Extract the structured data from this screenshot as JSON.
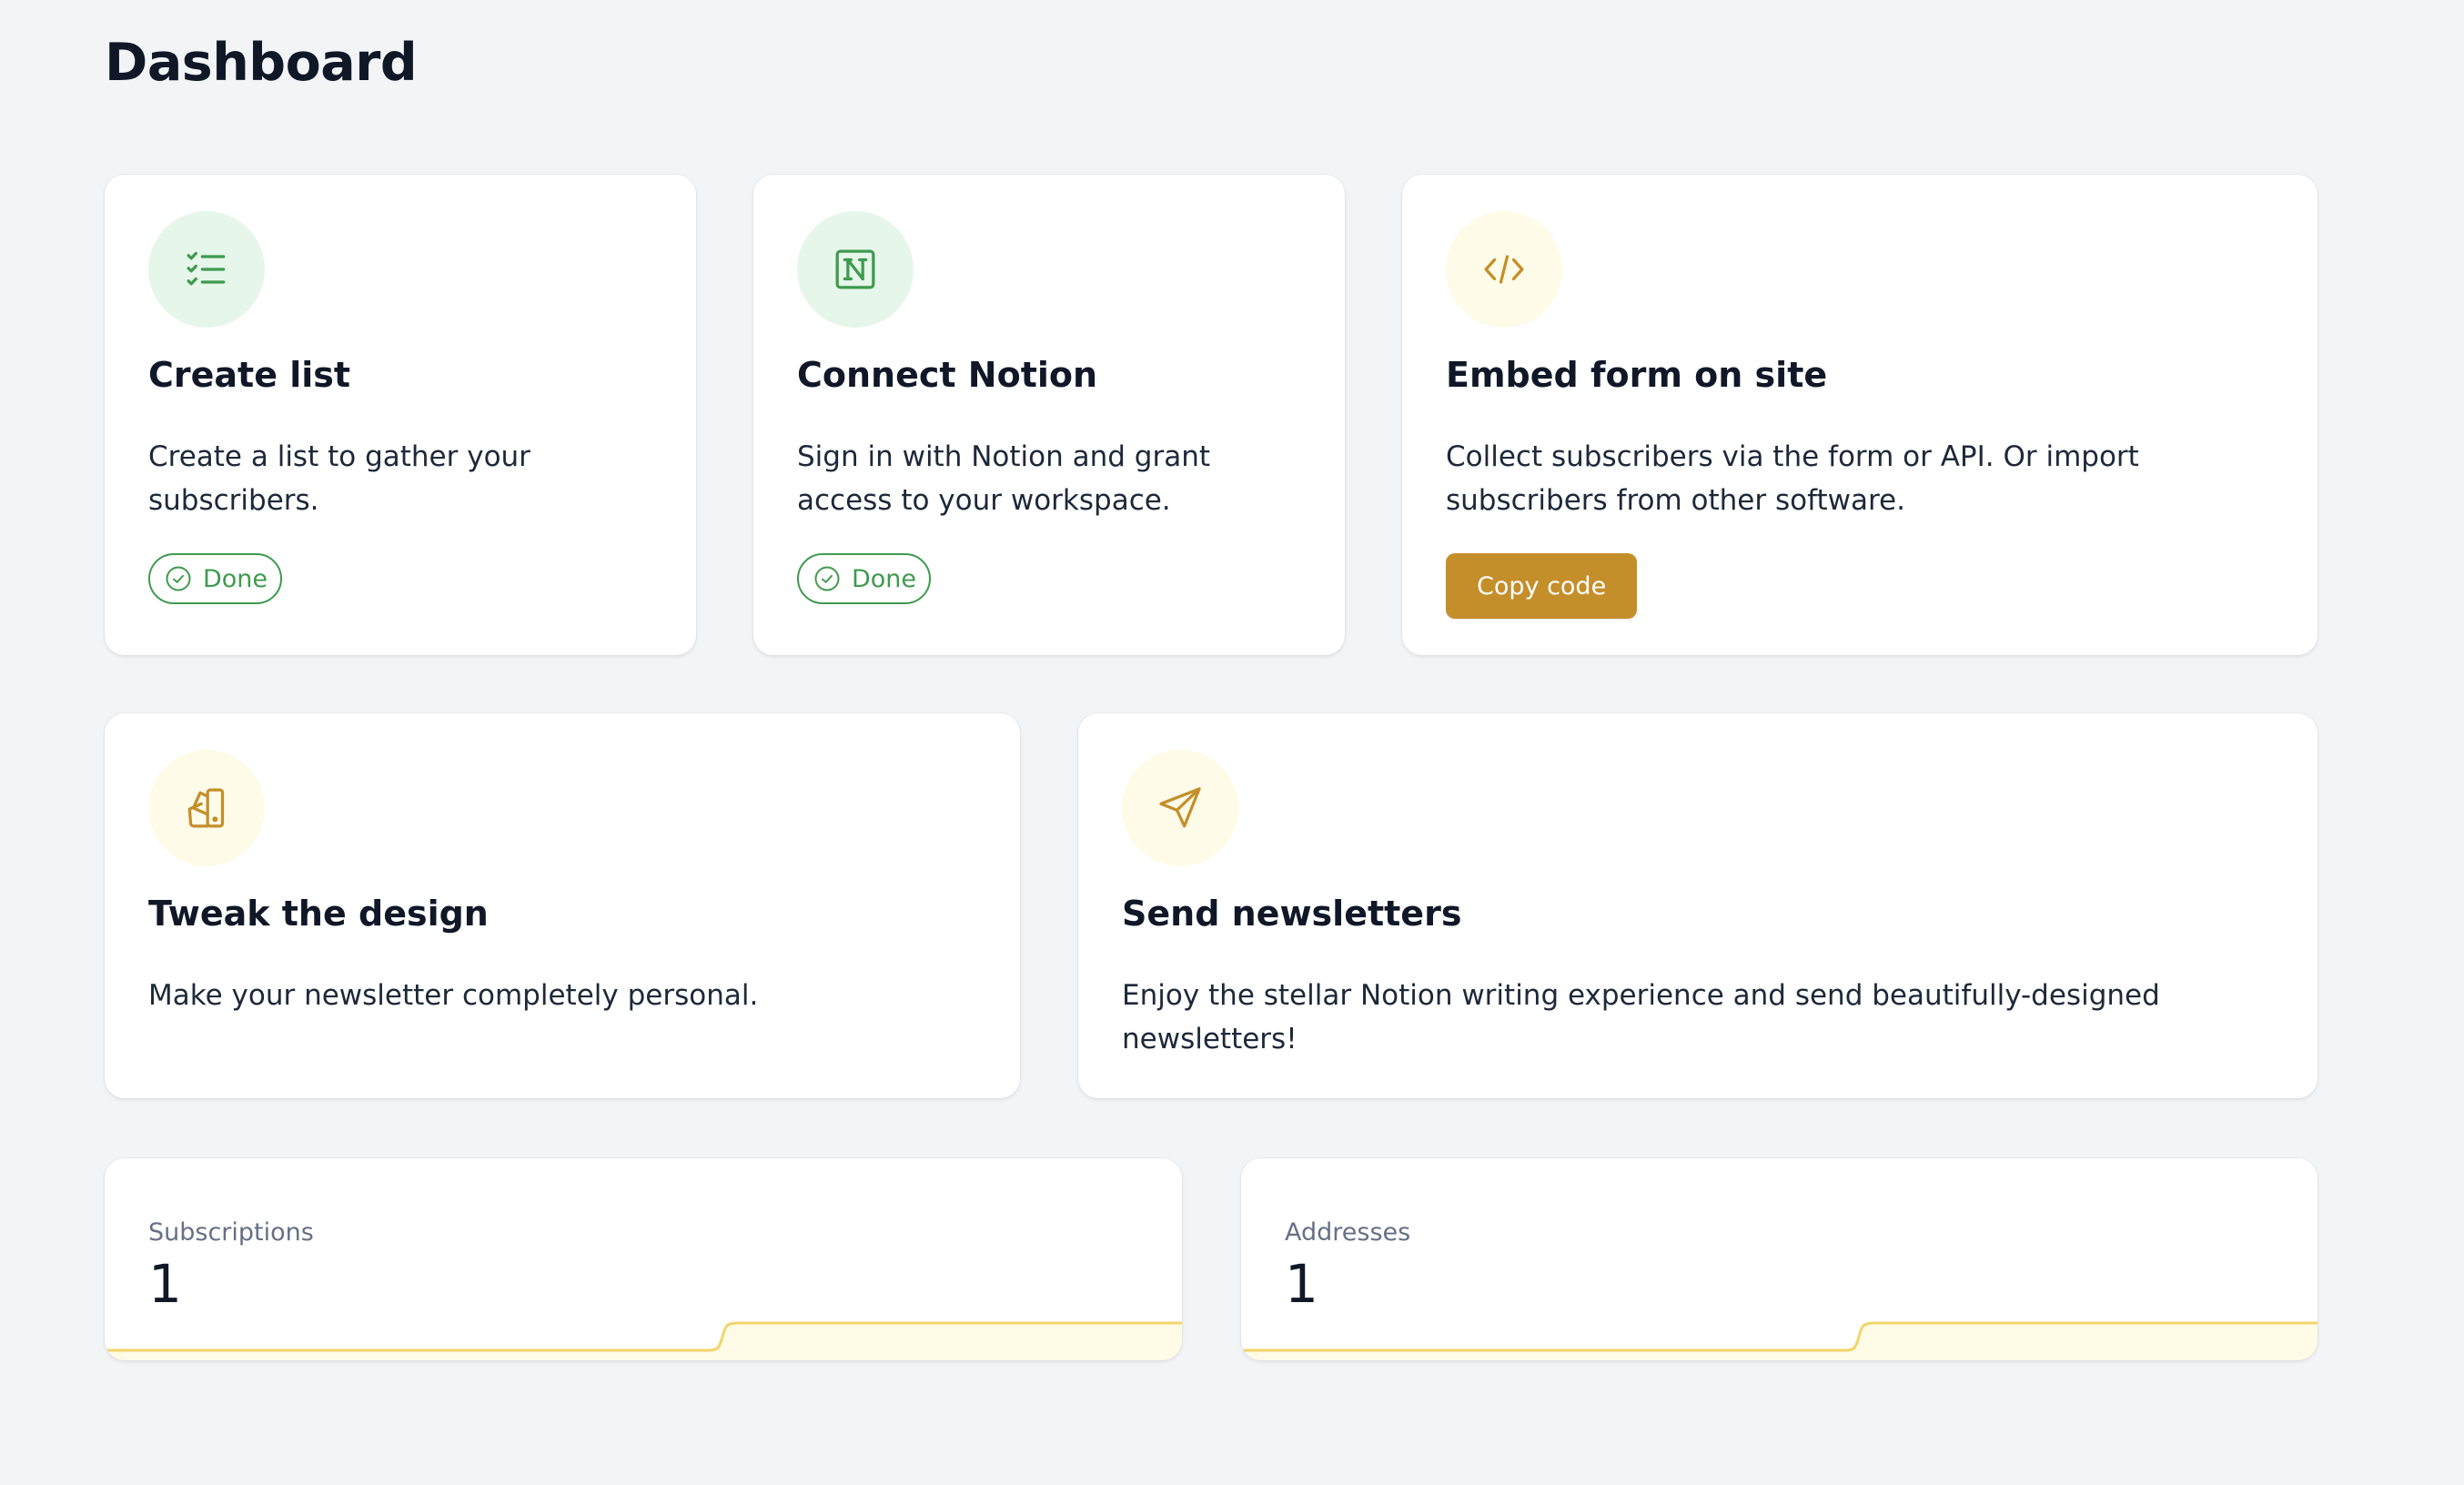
{
  "page": {
    "title": "Dashboard"
  },
  "cards": [
    {
      "icon": "checklist-icon",
      "title": "Create list",
      "description": "Create a list to gather your subscribers.",
      "status": "Done"
    },
    {
      "icon": "notion-logo-icon",
      "title": "Connect Notion",
      "description": "Sign in with Notion and grant access to your workspace.",
      "status": "Done"
    },
    {
      "icon": "code-icon",
      "title": "Embed form on site",
      "description": "Collect subscribers via the form or API. Or import subscribers from other software.",
      "action_label": "Copy code"
    },
    {
      "icon": "swatches-icon",
      "title": "Tweak the design",
      "description": "Make your newsletter completely personal."
    },
    {
      "icon": "paper-plane-icon",
      "title": "Send newsletters",
      "description": "Enjoy the stellar Notion writing experience and send beautifully-designed newsletters!"
    }
  ],
  "stats": [
    {
      "label": "Subscriptions",
      "value": "1"
    },
    {
      "label": "Addresses",
      "value": "1"
    }
  ],
  "colors": {
    "background": "#f3f4f6",
    "card": "#ffffff",
    "success_green": "#3f9a4f",
    "success_bg": "#e6f6ea",
    "accent_gold": "#c48f2b",
    "accent_bg": "#fefce8",
    "sparkline_stroke": "#f2d46a",
    "sparkline_fill": "#fefbe6"
  }
}
